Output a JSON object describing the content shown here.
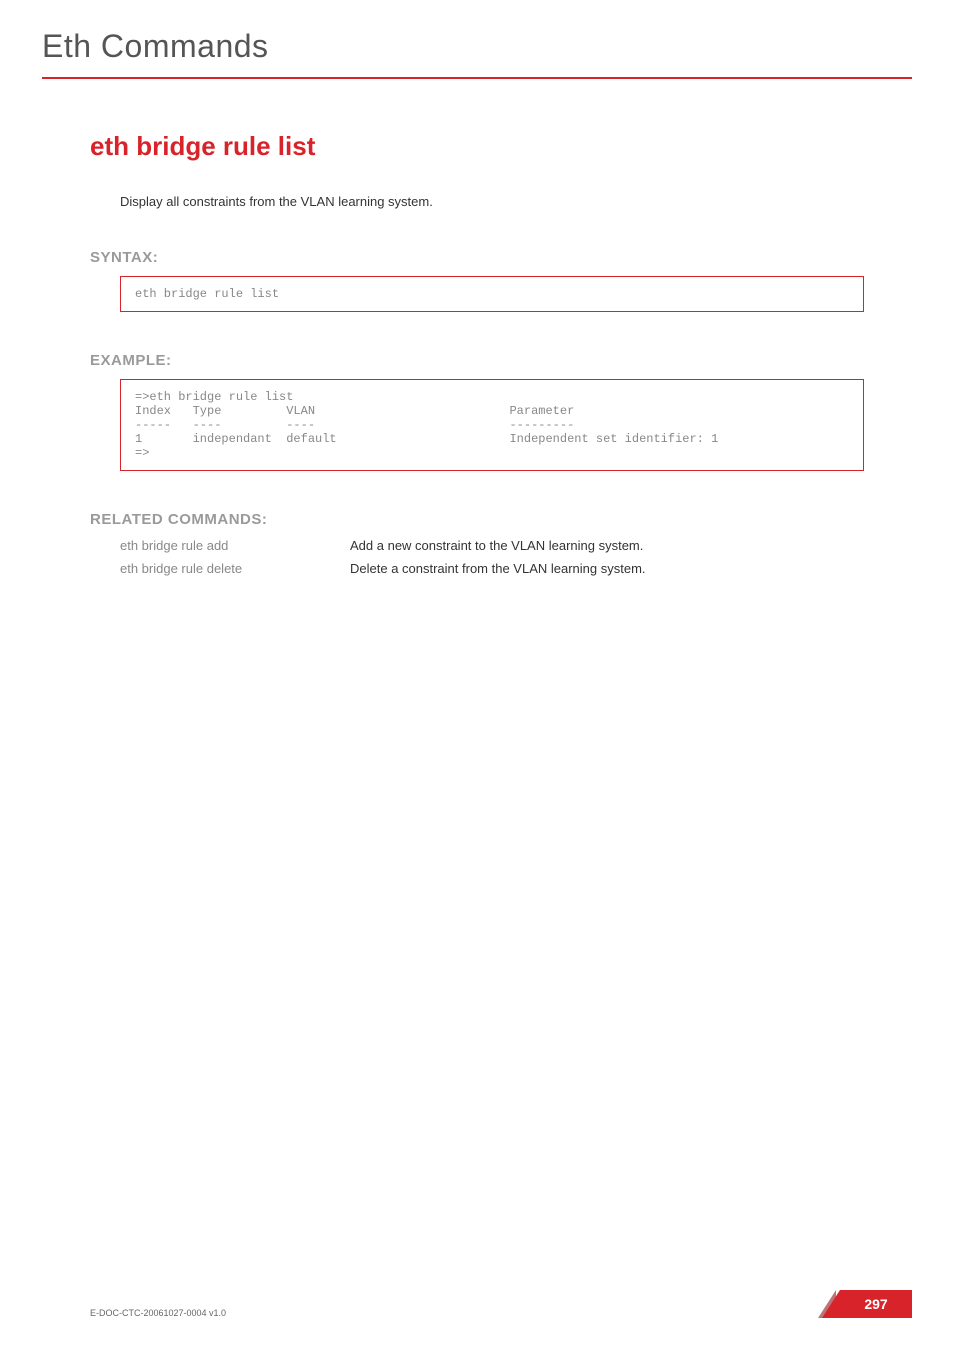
{
  "chapter": "Eth Commands",
  "command_title": "eth bridge rule list",
  "description": "Display all constraints from the VLAN learning system.",
  "syntax": {
    "heading": "SYNTAX:",
    "code": "eth bridge rule list"
  },
  "example": {
    "heading": "EXAMPLE:",
    "code": "=>eth bridge rule list\nIndex   Type         VLAN                           Parameter\n-----   ----         ----                           ---------\n1       independant  default                        Independent set identifier: 1\n=>"
  },
  "related": {
    "heading": "RELATED COMMANDS:",
    "rows": [
      {
        "cmd": "eth bridge rule add",
        "desc": "Add a new constraint to the VLAN learning system."
      },
      {
        "cmd": "eth bridge rule delete",
        "desc": "Delete a constraint from the VLAN learning system."
      }
    ]
  },
  "footer": {
    "doc_id": "E-DOC-CTC-20061027-0004 v1.0",
    "page": "297"
  }
}
